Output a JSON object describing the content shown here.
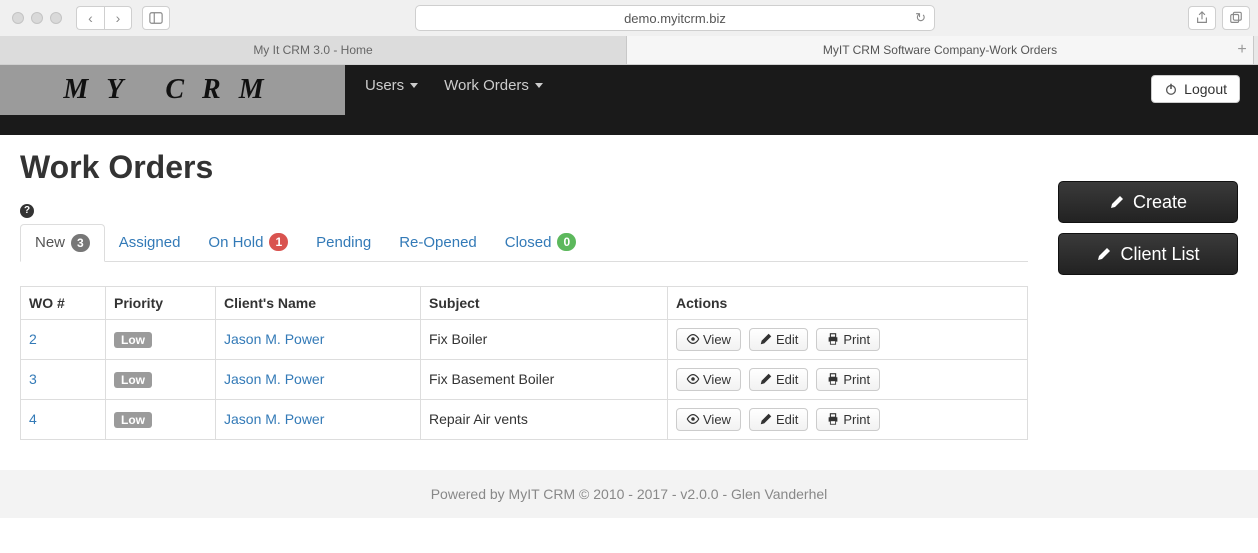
{
  "browser": {
    "url": "demo.myitcrm.biz",
    "tabs": [
      {
        "title": "My It CRM 3.0 - Home"
      },
      {
        "title": "MyIT CRM Software Company-Work Orders"
      }
    ]
  },
  "nav": {
    "brand": "MY CRM",
    "links": {
      "users": "Users",
      "work_orders": "Work Orders"
    },
    "logout": "Logout"
  },
  "page": {
    "title": "Work Orders",
    "tabs": [
      {
        "label": "New",
        "count": "3",
        "badge": "gray",
        "active": true
      },
      {
        "label": "Assigned"
      },
      {
        "label": "On Hold",
        "count": "1",
        "badge": "red"
      },
      {
        "label": "Pending"
      },
      {
        "label": "Re-Opened"
      },
      {
        "label": "Closed",
        "count": "0",
        "badge": "green"
      }
    ],
    "columns": {
      "wo": "WO #",
      "priority": "Priority",
      "client": "Client's Name",
      "subject": "Subject",
      "actions": "Actions"
    },
    "rows": [
      {
        "id": "2",
        "priority": "Low",
        "client": "Jason M. Power",
        "subject": "Fix Boiler"
      },
      {
        "id": "3",
        "priority": "Low",
        "client": "Jason M. Power",
        "subject": "Fix Basement Boiler"
      },
      {
        "id": "4",
        "priority": "Low",
        "client": "Jason M. Power",
        "subject": "Repair Air vents"
      }
    ],
    "action_labels": {
      "view": "View",
      "edit": "Edit",
      "print": "Print"
    }
  },
  "sidebar": {
    "create": "Create",
    "client_list": "Client List"
  },
  "footer": "Powered by MyIT CRM © 2010 - 2017 - v2.0.0 - Glen Vanderhel"
}
